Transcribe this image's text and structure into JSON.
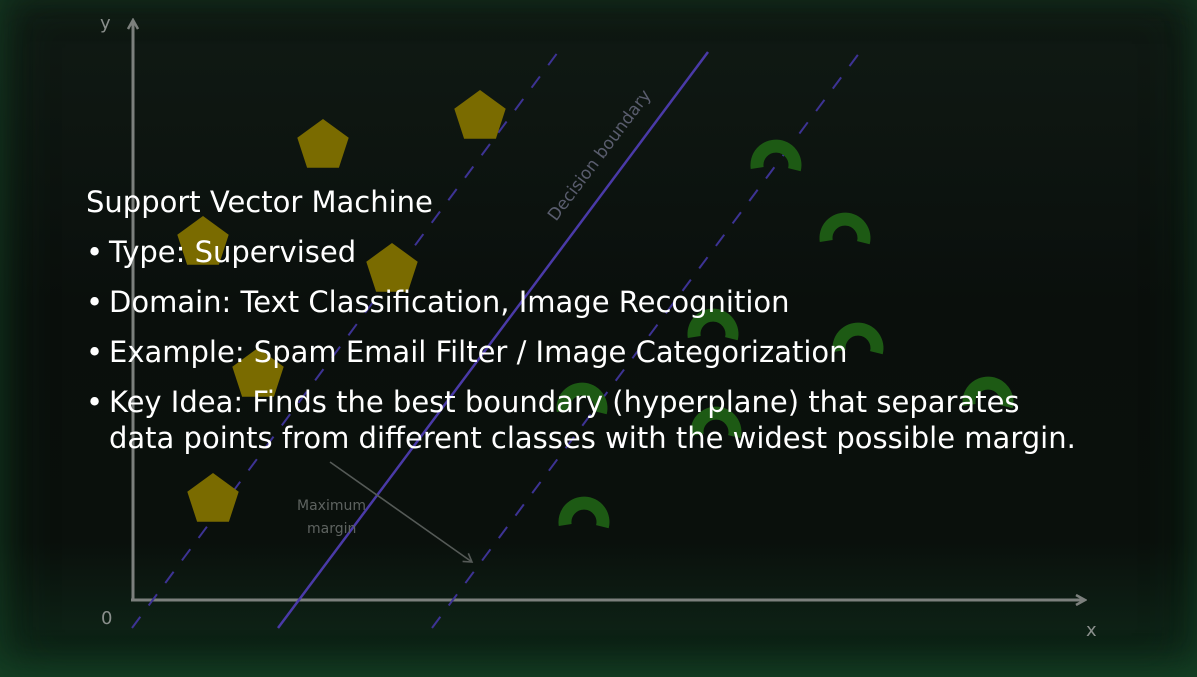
{
  "diagram": {
    "axes": {
      "x_label": "x",
      "y_label": "y",
      "origin_label": "0"
    },
    "boundary_label": "Decision boundary",
    "margin_label_line1": "Maximum",
    "margin_label_line2": "margin",
    "colors": {
      "pentagon": "#7a6b00",
      "arc": "#1d5a14",
      "boundary": "#4a3aa8",
      "margin_lines": "#3d3394",
      "axis": "#7c807d"
    },
    "class_a_shape": "pentagon",
    "class_b_shape": "arc"
  },
  "content": {
    "title": "Support Vector Machine",
    "bullets": [
      {
        "label": "Type: Supervised"
      },
      {
        "label": "Domain: Text Classification, Image Recognition"
      },
      {
        "label": "Example: Spam Email Filter / Image Categorization"
      },
      {
        "label": "Key Idea: Finds the best boundary (hyperplane) that separates data points from different classes with the widest possible margin."
      }
    ],
    "bullet_symbol": "•"
  }
}
